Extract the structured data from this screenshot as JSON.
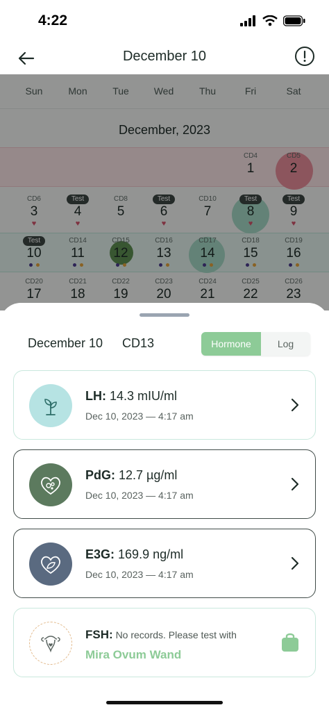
{
  "status": {
    "time": "4:22"
  },
  "header": {
    "title": "December 10"
  },
  "calendar": {
    "weekdays": [
      "Sun",
      "Mon",
      "Tue",
      "Wed",
      "Thu",
      "Fri",
      "Sat"
    ],
    "month": "December, 2023",
    "test_label": "Test",
    "days": [
      {
        "cd": "CD4",
        "num": "1"
      },
      {
        "cd": "CD5",
        "num": "2"
      },
      {
        "cd": "CD6",
        "num": "3"
      },
      {
        "cd": "",
        "num": "4"
      },
      {
        "cd": "CD8",
        "num": "5"
      },
      {
        "cd": "",
        "num": "6"
      },
      {
        "cd": "CD10",
        "num": "7"
      },
      {
        "cd": "",
        "num": "8"
      },
      {
        "cd": "",
        "num": "9"
      },
      {
        "cd": "",
        "num": "10"
      },
      {
        "cd": "CD14",
        "num": "11"
      },
      {
        "cd": "CD15",
        "num": "12"
      },
      {
        "cd": "CD16",
        "num": "13"
      },
      {
        "cd": "CD17",
        "num": "14"
      },
      {
        "cd": "CD18",
        "num": "15"
      },
      {
        "cd": "CD19",
        "num": "16"
      },
      {
        "cd": "CD20",
        "num": "17"
      },
      {
        "cd": "CD21",
        "num": "18"
      },
      {
        "cd": "CD22",
        "num": "19"
      },
      {
        "cd": "CD23",
        "num": "20"
      },
      {
        "cd": "CD24",
        "num": "21"
      },
      {
        "cd": "CD25",
        "num": "22"
      },
      {
        "cd": "CD26",
        "num": "23"
      }
    ]
  },
  "sheet": {
    "date": "December 10",
    "cycle_day": "CD13",
    "tabs": {
      "hormone": "Hormone",
      "log": "Log"
    },
    "cards": {
      "lh": {
        "name": "LH:",
        "value": "14.3 mIU/ml",
        "time": "Dec 10, 2023 — 4:17 am"
      },
      "pdg": {
        "name": "PdG:",
        "value": "12.7 µg/ml",
        "time": "Dec 10, 2023 — 4:17 am"
      },
      "e3g": {
        "name": "E3G:",
        "value": "169.9 ng/ml",
        "time": "Dec 10, 2023 — 4:17 am"
      },
      "fsh": {
        "name": "FSH:",
        "message": "No records. Please test with",
        "product": "Mira Ovum Wand"
      }
    }
  },
  "colors": {
    "accent": "#8dcb97",
    "lh_icon": "#b6e3e3",
    "pdg_icon": "#5c7a5e",
    "e3g_icon": "#5a6a80"
  },
  "icons": [
    "back-arrow-icon",
    "info-icon",
    "sprout-icon",
    "heart-cells-icon",
    "heart-leaf-icon",
    "uterus-icon",
    "chevron-right-icon",
    "shopping-bag-icon"
  ]
}
